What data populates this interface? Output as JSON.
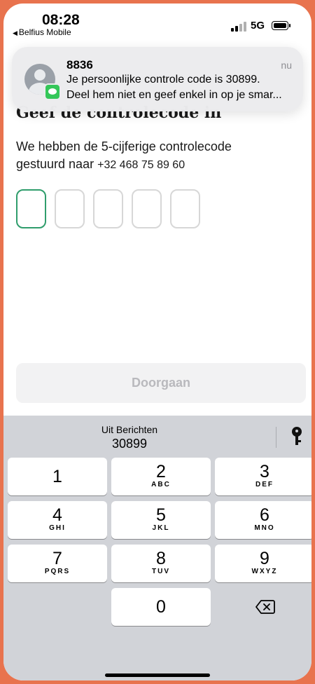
{
  "status_bar": {
    "time": "08:28",
    "back_app": "Belfius Mobile",
    "network": "5G"
  },
  "notification": {
    "sender": "8836",
    "time": "nu",
    "line1": "Je persoonlijke controle code is 30899.",
    "line2": "Deel hem niet en geef enkel in op je smar..."
  },
  "page": {
    "heading": "Geef de controlecode in",
    "description_line1": "We hebben de 5-cijferige controlecode",
    "description_line2": "gestuurd naar",
    "phone_number": "+32 468 75 89 60",
    "code_digits": [
      "",
      "",
      "",
      "",
      ""
    ],
    "continue_label": "Doorgaan"
  },
  "keyboard": {
    "suggestion_source": "Uit Berichten",
    "suggestion_code": "30899",
    "keys": [
      {
        "num": "1",
        "letters": ""
      },
      {
        "num": "2",
        "letters": "ABC"
      },
      {
        "num": "3",
        "letters": "DEF"
      },
      {
        "num": "4",
        "letters": "GHI"
      },
      {
        "num": "5",
        "letters": "JKL"
      },
      {
        "num": "6",
        "letters": "MNO"
      },
      {
        "num": "7",
        "letters": "PQRS"
      },
      {
        "num": "8",
        "letters": "TUV"
      },
      {
        "num": "9",
        "letters": "WXYZ"
      },
      {
        "num": "0",
        "letters": ""
      }
    ]
  },
  "colors": {
    "frame": "#e8734e",
    "active_border": "#2f9d6c",
    "messages_green": "#34c759",
    "keyboard_bg": "#d1d3d8"
  }
}
